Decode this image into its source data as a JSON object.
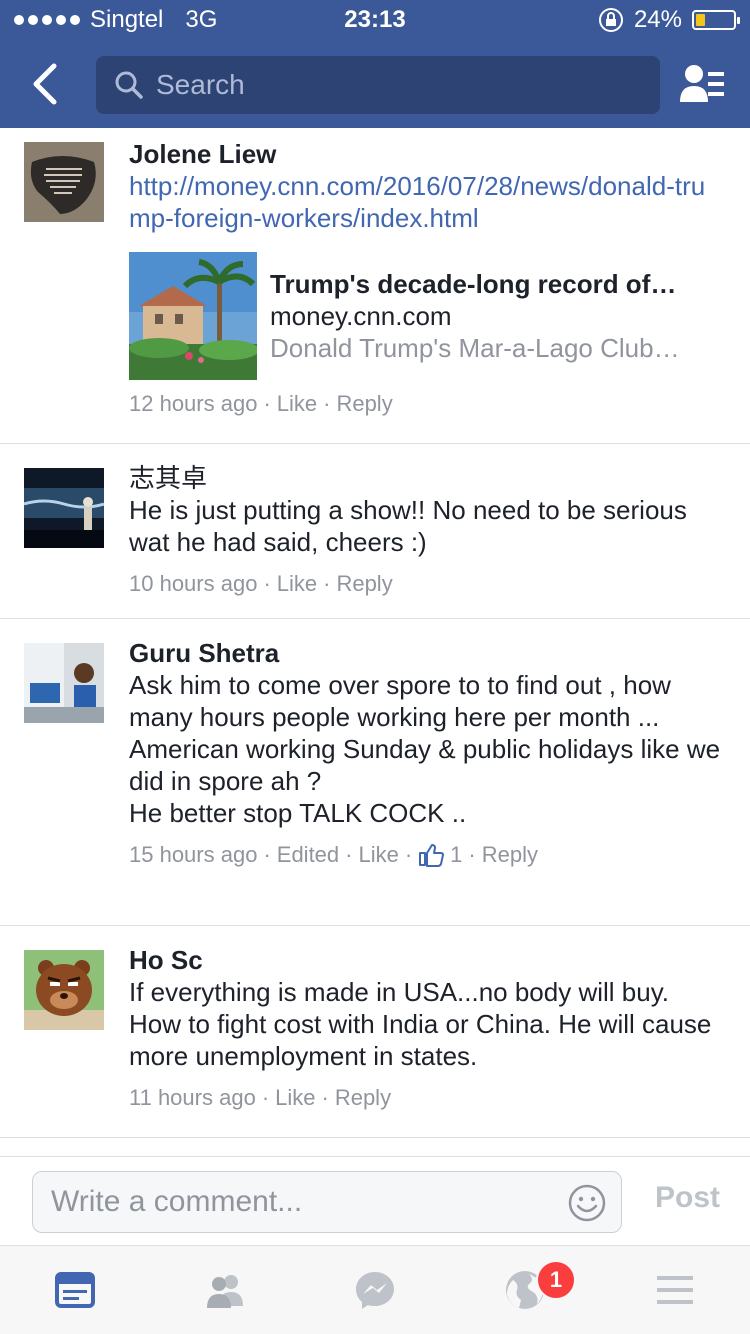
{
  "status": {
    "carrier": "Singtel",
    "network": "3G",
    "time": "23:13",
    "battery": "24%"
  },
  "nav": {
    "search_placeholder": "Search"
  },
  "comments": [
    {
      "name": "Jolene Liew",
      "link": "http://money.cnn.com/2016/07/28/news/donald-trump-foreign-workers/index.html",
      "preview": {
        "title": "Trump's decade-long record of…",
        "domain": "money.cnn.com",
        "desc": "Donald Trump's Mar-a-Lago Club…"
      },
      "time": "12 hours ago",
      "like": "Like",
      "reply": "Reply"
    },
    {
      "name": "志其卓",
      "text": "He is just putting a show!!  No need to be serious wat he had said, cheers :)",
      "time": "10 hours ago",
      "like": "Like",
      "reply": "Reply"
    },
    {
      "name": "Guru Shetra",
      "text": "Ask him to come over spore to to find out , how many hours people working here  per month ...\nAmerican working Sunday & public holidays like we did in spore ah ?\nHe better stop TALK COCK ..",
      "time": "15 hours ago",
      "edited": "Edited",
      "like": "Like",
      "like_count": "1",
      "reply": "Reply"
    },
    {
      "name": "Ho Sc",
      "text": "If everything is made in USA...no body will buy. How to fight cost with India or China.  He will cause more unemployment in states.",
      "time": "11 hours ago",
      "like": "Like",
      "reply": "Reply"
    }
  ],
  "composer": {
    "placeholder": "Write a comment...",
    "post_label": "Post"
  },
  "tabbar": {
    "notifications_badge": "1"
  },
  "colors": {
    "brand": "#3b5998",
    "link": "#4267b2",
    "meta": "#90949c",
    "badge": "#fa3e3e"
  }
}
